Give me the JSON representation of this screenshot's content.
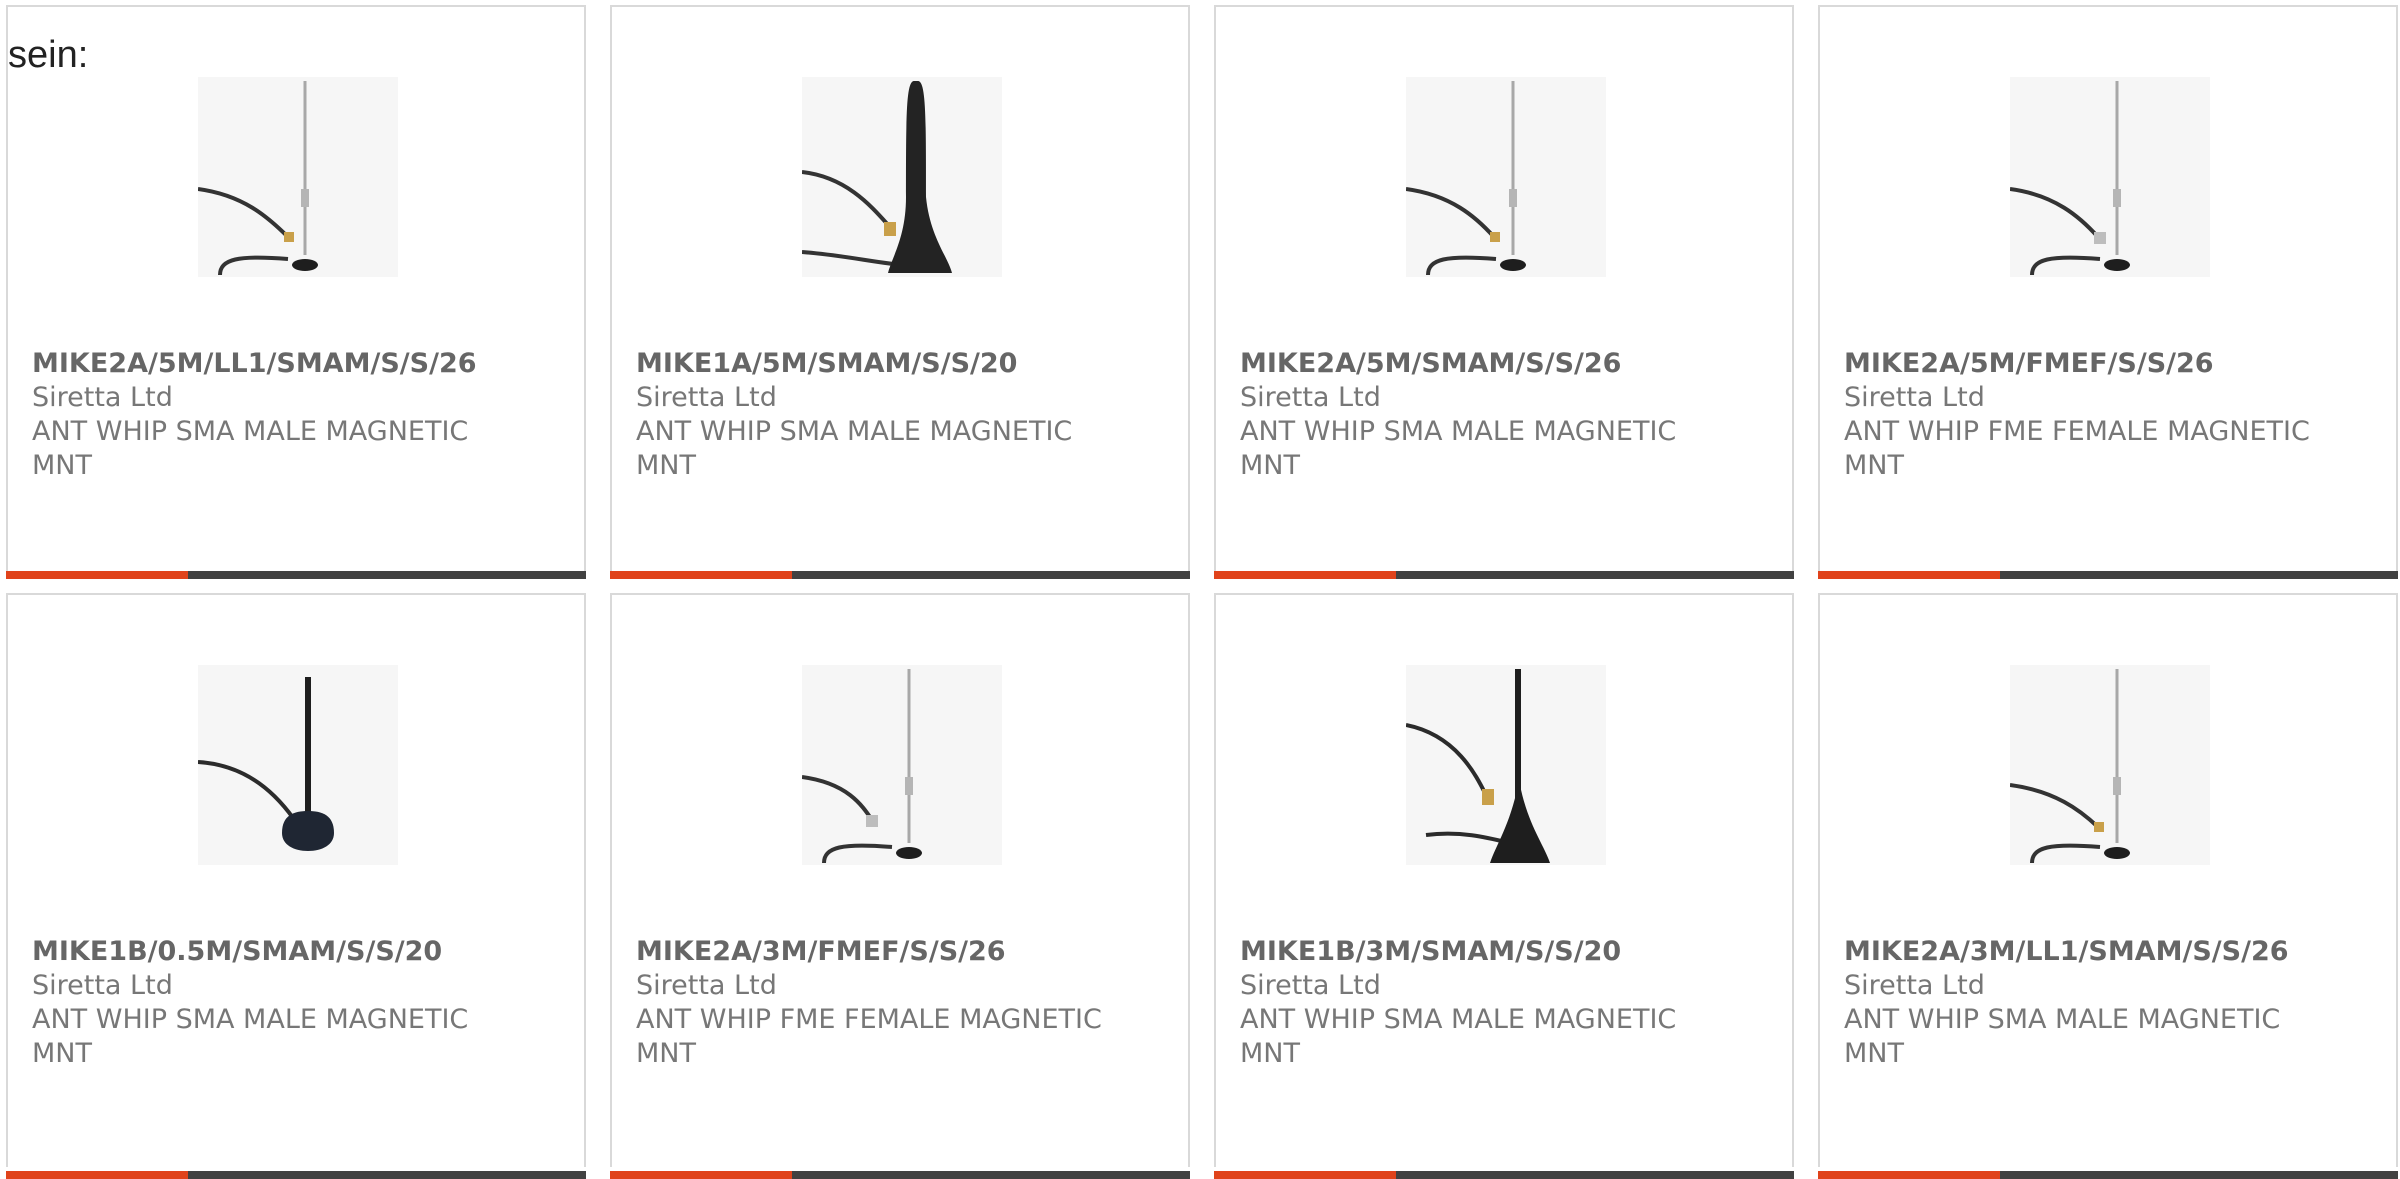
{
  "intro_text": "sein:",
  "colors": {
    "accent_bar": "#e0431b",
    "dark_bar": "#414141",
    "card_border": "#d9d9d9",
    "text": "#777777"
  },
  "products": [
    {
      "part_number": "MIKE2A/5M/LL1/SMAM/S/S/26",
      "manufacturer": "Siretta Ltd",
      "description": "ANT WHIP SMA MALE MAGNETIC MNT",
      "image_icon": "whip-antenna-icon"
    },
    {
      "part_number": "MIKE1A/5M/SMAM/S/S/20",
      "manufacturer": "Siretta Ltd",
      "description": "ANT WHIP SMA MALE MAGNETIC MNT",
      "image_icon": "stubby-antenna-icon"
    },
    {
      "part_number": "MIKE2A/5M/SMAM/S/S/26",
      "manufacturer": "Siretta Ltd",
      "description": "ANT WHIP SMA MALE MAGNETIC MNT",
      "image_icon": "whip-antenna-icon"
    },
    {
      "part_number": "MIKE2A/5M/FMEF/S/S/26",
      "manufacturer": "Siretta Ltd",
      "description": "ANT WHIP FME FEMALE MAGNETIC MNT",
      "image_icon": "whip-antenna-icon"
    },
    {
      "part_number": "MIKE1B/0.5M/SMAM/S/S/20",
      "manufacturer": "Siretta Ltd",
      "description": "ANT WHIP SMA MALE MAGNETIC MNT",
      "image_icon": "short-whip-antenna-icon"
    },
    {
      "part_number": "MIKE2A/3M/FMEF/S/S/26",
      "manufacturer": "Siretta Ltd",
      "description": "ANT WHIP FME FEMALE MAGNETIC MNT",
      "image_icon": "whip-antenna-icon"
    },
    {
      "part_number": "MIKE1B/3M/SMAM/S/S/20",
      "manufacturer": "Siretta Ltd",
      "description": "ANT WHIP SMA MALE MAGNETIC MNT",
      "image_icon": "short-whip-antenna-icon"
    },
    {
      "part_number": "MIKE2A/3M/LL1/SMAM/S/S/26",
      "manufacturer": "Siretta Ltd",
      "description": "ANT WHIP SMA MALE MAGNETIC MNT",
      "image_icon": "whip-antenna-icon"
    }
  ]
}
